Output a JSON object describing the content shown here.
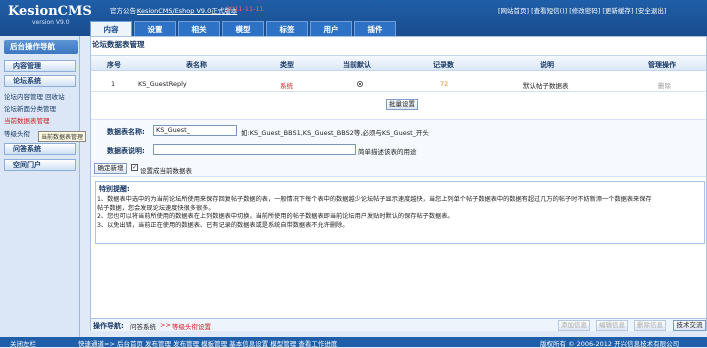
{
  "header": {
    "app_name": "KesionCMS",
    "version": "version V9.0",
    "notice_label": "官方公告:",
    "notice_link": "KesionCMS/Eshop V9.0正式版本",
    "notice_tag": "2011-11-11",
    "top_links": [
      "[网站首页]",
      "[查看短信()]",
      "[修改密码]",
      "[更新缓存]",
      "[安全退出]"
    ]
  },
  "tabs": [
    "内容",
    "设置",
    "相关",
    "模型",
    "标签",
    "用户",
    "插件"
  ],
  "sidebar": {
    "title": "后台操作导航",
    "sections": [
      "内容管理",
      "论坛系统",
      "问答系统",
      "空间门户"
    ],
    "forum_links": [
      "论坛内容管理",
      "回收站",
      "论坛新面分类管理",
      "当前数据表管理",
      "等级头衔"
    ],
    "tooltip": "当前数据表管理"
  },
  "page": {
    "title": "论坛数据表管理",
    "columns": [
      "序号",
      "表名称",
      "类型",
      "当前默认",
      "记录数",
      "说明",
      "管理操作"
    ],
    "rows": [
      {
        "no": "1",
        "name": "KS_GuestReply",
        "type": "系统",
        "records": "72",
        "desc": "默认帖子数据表",
        "op": "删除"
      }
    ],
    "batch_button": "批量设置",
    "form": {
      "name_label": "数据表名称:",
      "name_value": "KS_Guest_",
      "name_hint": "如:KS_Guest_BBS1,KS_Guest_BBS2等,必须与KS_Guest_开头",
      "desc_label": "数据表说明:",
      "desc_value": "",
      "desc_hint": "简单描述该表的用途",
      "confirm_button": "确定新增",
      "set_default_label": "设置成当前数据表"
    },
    "tips": {
      "title": "特别提醒:",
      "lines": [
        "1、数据表中选中的为当前论坛所使用来保存回复帖子数据的表，一般情况下每个表中的数据越少论坛帖子显示速度越快，当您上列单个帖子数据表中的数据有超过几万的帖子时不妨新添一个数据表来保存",
        "帖子数据，您会发现论坛速度快很多很多。",
        "2、您也可以将当前所使用的数据表在上列数据表中切换，当前所使用的帖子数据表即当前论坛用户发贴时默认的保存帖子数据表。",
        "3、以免出错，当前正在使用的数据表、已有记录的数据表或是系统自带数据表不允许删除。"
      ]
    },
    "op_nav": {
      "label": "操作导航:",
      "crumb1": "问答系统",
      "sep": ">>",
      "crumb2": "等级头衔设置"
    },
    "bottom_buttons": [
      "添加信息",
      "编辑信息",
      "删除信息",
      "技术交流"
    ]
  },
  "footer": {
    "left": "关闭左栏",
    "links": "快速通道=> 后台首页 发布管理 发布管理 模板管理 基本信息设置 模型管理 查看工作进度",
    "copyright": "版权所有 © 2006-2012 开兴信息技术有限公司"
  },
  "colors": {
    "header_bg": "#1f5ea8",
    "accent_red": "#d02020",
    "record_orange": "#e08a1e"
  }
}
